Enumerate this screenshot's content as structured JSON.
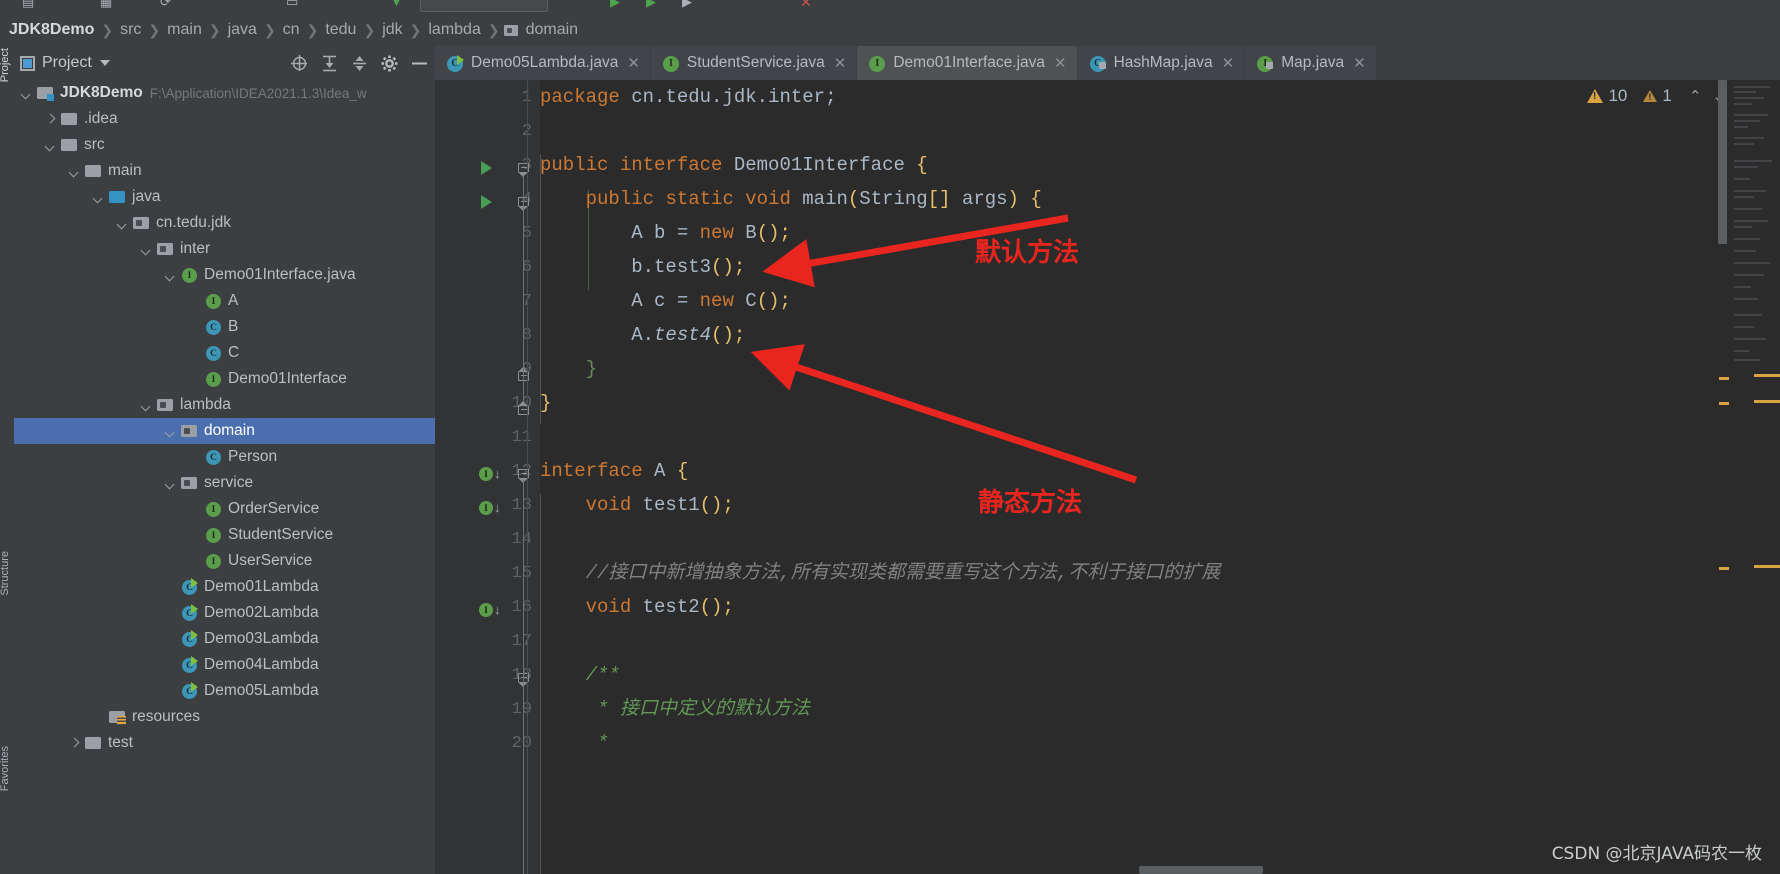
{
  "window": {
    "breadcrumb": [
      "JDK8Demo",
      "src",
      "main",
      "java",
      "cn",
      "tedu",
      "jdk",
      "lambda",
      "domain"
    ],
    "watermark": "CSDN @北京JAVA码农一枚"
  },
  "left_strip": {
    "top_tab": "Project",
    "mid_tab": "Structure",
    "bottom_tab": "Favorites"
  },
  "project_panel": {
    "title": "Project",
    "tools": [
      "locate-icon",
      "collapse-all-icon",
      "expand-icon",
      "settings-icon",
      "hide-icon"
    ]
  },
  "tree": [
    {
      "label": "JDK8Demo",
      "path": "F:\\Application\\IDEA2021.1.3\\Idea_w",
      "depth": 0,
      "arrow": "down",
      "icon": "module",
      "kind": "root",
      "selected": false
    },
    {
      "label": ".idea",
      "path": "",
      "depth": 1,
      "arrow": "right",
      "icon": "folder",
      "kind": "folder",
      "selected": false
    },
    {
      "label": "src",
      "path": "",
      "depth": 1,
      "arrow": "down",
      "icon": "folder",
      "kind": "folder",
      "selected": false
    },
    {
      "label": "main",
      "path": "",
      "depth": 2,
      "arrow": "down",
      "icon": "folder",
      "kind": "folder",
      "selected": false
    },
    {
      "label": "java",
      "path": "",
      "depth": 3,
      "arrow": "down",
      "icon": "folder-blue",
      "kind": "source-root",
      "selected": false
    },
    {
      "label": "cn.tedu.jdk",
      "path": "",
      "depth": 4,
      "arrow": "down",
      "icon": "package",
      "kind": "package",
      "selected": false
    },
    {
      "label": "inter",
      "path": "",
      "depth": 5,
      "arrow": "down",
      "icon": "package",
      "kind": "package",
      "selected": false
    },
    {
      "label": "Demo01Interface.java",
      "path": "",
      "depth": 6,
      "arrow": "down",
      "icon": "interface",
      "kind": "interface-file",
      "selected": false
    },
    {
      "label": "A",
      "path": "",
      "depth": 7,
      "arrow": "none",
      "icon": "interface",
      "kind": "interface",
      "selected": false
    },
    {
      "label": "B",
      "path": "",
      "depth": 7,
      "arrow": "none",
      "icon": "class",
      "kind": "class",
      "selected": false
    },
    {
      "label": "C",
      "path": "",
      "depth": 7,
      "arrow": "none",
      "icon": "class",
      "kind": "class",
      "selected": false
    },
    {
      "label": "Demo01Interface",
      "path": "",
      "depth": 7,
      "arrow": "none",
      "icon": "interface",
      "kind": "interface",
      "selected": false
    },
    {
      "label": "lambda",
      "path": "",
      "depth": 5,
      "arrow": "down",
      "icon": "package",
      "kind": "package",
      "selected": false
    },
    {
      "label": "domain",
      "path": "",
      "depth": 6,
      "arrow": "down",
      "icon": "package",
      "kind": "package",
      "selected": true
    },
    {
      "label": "Person",
      "path": "",
      "depth": 7,
      "arrow": "none",
      "icon": "class",
      "kind": "class",
      "selected": false
    },
    {
      "label": "service",
      "path": "",
      "depth": 6,
      "arrow": "down",
      "icon": "package",
      "kind": "package",
      "selected": false
    },
    {
      "label": "OrderService",
      "path": "",
      "depth": 7,
      "arrow": "none",
      "icon": "interface",
      "kind": "interface",
      "selected": false
    },
    {
      "label": "StudentService",
      "path": "",
      "depth": 7,
      "arrow": "none",
      "icon": "interface",
      "kind": "interface",
      "selected": false
    },
    {
      "label": "UserService",
      "path": "",
      "depth": 7,
      "arrow": "none",
      "icon": "interface",
      "kind": "interface",
      "selected": false
    },
    {
      "label": "Demo01Lambda",
      "path": "",
      "depth": 6,
      "arrow": "none",
      "icon": "class-run",
      "kind": "class",
      "selected": false
    },
    {
      "label": "Demo02Lambda",
      "path": "",
      "depth": 6,
      "arrow": "none",
      "icon": "class-run",
      "kind": "class",
      "selected": false
    },
    {
      "label": "Demo03Lambda",
      "path": "",
      "depth": 6,
      "arrow": "none",
      "icon": "class-run",
      "kind": "class",
      "selected": false
    },
    {
      "label": "Demo04Lambda",
      "path": "",
      "depth": 6,
      "arrow": "none",
      "icon": "class-run",
      "kind": "class",
      "selected": false
    },
    {
      "label": "Demo05Lambda",
      "path": "",
      "depth": 6,
      "arrow": "none",
      "icon": "class-run",
      "kind": "class",
      "selected": false
    },
    {
      "label": "resources",
      "path": "",
      "depth": 3,
      "arrow": "none",
      "icon": "resources",
      "kind": "resource-root",
      "selected": false
    },
    {
      "label": "test",
      "path": "",
      "depth": 2,
      "arrow": "right",
      "icon": "folder",
      "kind": "folder",
      "selected": false
    }
  ],
  "tabs": [
    {
      "label": "Demo05Lambda.java",
      "icon": "class-run",
      "active": false,
      "closable": true,
      "locked": false
    },
    {
      "label": "StudentService.java",
      "icon": "interface",
      "active": false,
      "closable": true,
      "locked": false
    },
    {
      "label": "Demo01Interface.java",
      "icon": "interface",
      "active": true,
      "closable": true,
      "locked": false
    },
    {
      "label": "HashMap.java",
      "icon": "class",
      "active": false,
      "closable": true,
      "locked": true
    },
    {
      "label": "Map.java",
      "icon": "interface",
      "active": false,
      "closable": true,
      "locked": true
    }
  ],
  "inspection": {
    "warning_count": "10",
    "weak_warning_count": "1",
    "prev_label": "prev-problem-icon",
    "next_label": "next-problem-icon"
  },
  "code": {
    "file": "Demo01Interface.java",
    "lines": [
      {
        "n": 1,
        "text": "package cn.tedu.jdk.inter;"
      },
      {
        "n": 2,
        "text": ""
      },
      {
        "n": 3,
        "text": "public interface Demo01Interface {"
      },
      {
        "n": 4,
        "text": "    public static void main(String[] args) {"
      },
      {
        "n": 5,
        "text": "        A b = new B();"
      },
      {
        "n": 6,
        "text": "        b.test3();"
      },
      {
        "n": 7,
        "text": "        A c = new C();"
      },
      {
        "n": 8,
        "text": "        A.test4();"
      },
      {
        "n": 9,
        "text": "    }"
      },
      {
        "n": 10,
        "text": "}"
      },
      {
        "n": 11,
        "text": ""
      },
      {
        "n": 12,
        "text": "interface A {"
      },
      {
        "n": 13,
        "text": "    void test1();"
      },
      {
        "n": 14,
        "text": ""
      },
      {
        "n": 15,
        "text": "    //接口中新增抽象方法,所有实现类都需要重写这个方法,不利于接口的扩展"
      },
      {
        "n": 16,
        "text": "    void test2();"
      },
      {
        "n": 17,
        "text": ""
      },
      {
        "n": 18,
        "text": "    /**"
      },
      {
        "n": 19,
        "text": "     * 接口中定义的默认方法"
      },
      {
        "n": 20,
        "text": "     *"
      }
    ]
  },
  "annotations": [
    {
      "text": "默认方法",
      "target_line": 6,
      "color": "#e8251f"
    },
    {
      "text": "静态方法",
      "target_line": 8,
      "color": "#e8251f"
    }
  ],
  "colors": {
    "accent_selection": "#4b6eaf",
    "editor_bg": "#2b2b2b",
    "panel_bg": "#3c3f41",
    "keyword": "#cc7832",
    "string": "#6a8759",
    "comment": "#808080",
    "doc_comment": "#629755",
    "annotation_red": "#e8251f",
    "warning_yellow": "#d9a343"
  }
}
